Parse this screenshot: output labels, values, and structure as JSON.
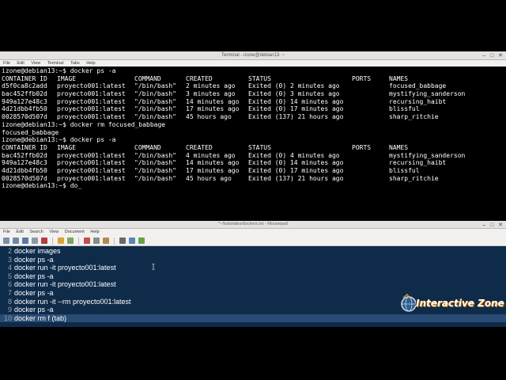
{
  "terminal": {
    "title": "Terminal - izone@debian13: ~",
    "menu": [
      "File",
      "Edit",
      "View",
      "Terminal",
      "Tabs",
      "Help"
    ],
    "lines": [
      {
        "type": "prompt",
        "text": "izone@debian13:~$ docker ps -a"
      },
      {
        "type": "row",
        "cols": [
          "CONTAINER ID",
          "IMAGE",
          "COMMAND",
          "CREATED",
          "STATUS",
          "PORTS",
          "NAMES"
        ]
      },
      {
        "type": "row",
        "cols": [
          "d5f0ca8c2add",
          "proyecto001:latest",
          "\"/bin/bash\"",
          "2 minutes ago",
          "Exited (0) 2 minutes ago",
          "",
          "focused_babbage"
        ]
      },
      {
        "type": "row",
        "cols": [
          "bac452ffb02d",
          "proyecto001:latest",
          "\"/bin/bash\"",
          "3 minutes ago",
          "Exited (0) 3 minutes ago",
          "",
          "mystifying_sanderson"
        ]
      },
      {
        "type": "row",
        "cols": [
          "949a127e48c3",
          "proyecto001:latest",
          "\"/bin/bash\"",
          "14 minutes ago",
          "Exited (0) 14 minutes ago",
          "",
          "recursing_haibt"
        ]
      },
      {
        "type": "row",
        "cols": [
          "4d21dbb4fb50",
          "proyecto001:latest",
          "\"/bin/bash\"",
          "17 minutes ago",
          "Exited (0) 17 minutes ago",
          "",
          "blissful"
        ]
      },
      {
        "type": "row",
        "cols": [
          "0028570d507d",
          "proyecto001:latest",
          "\"/bin/bash\"",
          "45 hours ago",
          "Exited (137) 21 hours ago",
          "",
          "sharp_ritchie"
        ]
      },
      {
        "type": "prompt",
        "text": "izone@debian13:~$ docker rm focused_babbage"
      },
      {
        "type": "plain",
        "text": "focused_babbage"
      },
      {
        "type": "prompt",
        "text": "izone@debian13:~$ docker ps -a"
      },
      {
        "type": "row",
        "cols": [
          "CONTAINER ID",
          "IMAGE",
          "COMMAND",
          "CREATED",
          "STATUS",
          "PORTS",
          "NAMES"
        ]
      },
      {
        "type": "row",
        "cols": [
          "bac452ffb02d",
          "proyecto001:latest",
          "\"/bin/bash\"",
          "4 minutes ago",
          "Exited (0) 4 minutes ago",
          "",
          "mystifying_sanderson"
        ]
      },
      {
        "type": "row",
        "cols": [
          "949a127e48c3",
          "proyecto001:latest",
          "\"/bin/bash\"",
          "14 minutes ago",
          "Exited (0) 14 minutes ago",
          "",
          "recursing_haibt"
        ]
      },
      {
        "type": "row",
        "cols": [
          "4d21dbb4fb50",
          "proyecto001:latest",
          "\"/bin/bash\"",
          "17 minutes ago",
          "Exited (0) 17 minutes ago",
          "",
          "blissful"
        ]
      },
      {
        "type": "row",
        "cols": [
          "0028570d507d",
          "proyecto001:latest",
          "\"/bin/bash\"",
          "45 hours ago",
          "Exited (137) 21 hours ago",
          "",
          "sharp_ritchie"
        ]
      },
      {
        "type": "prompt",
        "text": "izone@debian13:~$ do_"
      }
    ]
  },
  "mousepad": {
    "title": "*~/tutoriales/dockers.txt - Mousepad",
    "menu": [
      "File",
      "Edit",
      "Search",
      "View",
      "Document",
      "Help"
    ],
    "lines": [
      {
        "num": "2",
        "text": "docker images"
      },
      {
        "num": "3",
        "text": "docker ps -a"
      },
      {
        "num": "4",
        "text": "docker run -it proyecto001:latest"
      },
      {
        "num": "5",
        "text": "docker ps -a"
      },
      {
        "num": "6",
        "text": "docker run -it proyecto001:latest"
      },
      {
        "num": "7",
        "text": "docker ps -a"
      },
      {
        "num": "8",
        "text": "docker run -it --rm proyecto001:latest"
      },
      {
        "num": "9",
        "text": "docker ps -a"
      },
      {
        "num": "10",
        "text": "docker rm f (tab)"
      }
    ],
    "current_line": "10"
  },
  "logo": {
    "text": "Interactive Zone"
  },
  "colors": {
    "editor_bg": "#0f2b4a",
    "current_line": "#2a4b73",
    "terminal_bg": "#000000"
  }
}
